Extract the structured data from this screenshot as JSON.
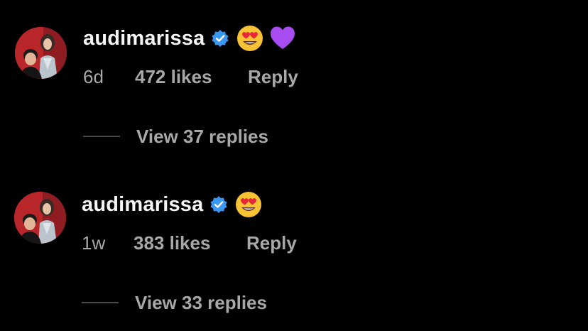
{
  "comments": [
    {
      "username": "audimarissa",
      "verified": true,
      "emojis": [
        "heart-eyes-emoji",
        "purple-heart-emoji"
      ],
      "time": "6d",
      "likes": "472 likes",
      "reply_label": "Reply",
      "view_replies": "View 37 replies"
    },
    {
      "username": "audimarissa",
      "verified": true,
      "emojis": [
        "heart-eyes-emoji"
      ],
      "time": "1w",
      "likes": "383 likes",
      "reply_label": "Reply",
      "view_replies": "View 33 replies"
    }
  ],
  "colors": {
    "background": "#000000",
    "username": "#f5f5f5",
    "secondary_text": "#a8a8a8",
    "verified_badge": "#3897f0",
    "avatar_bg": "#b8262a",
    "purple_heart": "#a64cf0"
  }
}
